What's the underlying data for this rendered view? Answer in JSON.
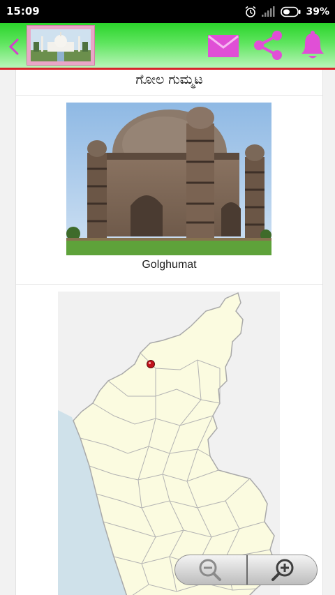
{
  "status_bar": {
    "time": "15:09",
    "battery_percent": "39%",
    "icons": [
      "alarm-icon",
      "signal-icon",
      "battery-icon"
    ]
  },
  "app_bar": {
    "icons": [
      "back-icon",
      "mail-icon",
      "share-icon",
      "bell-icon"
    ],
    "accent_color": "#e04fd6",
    "background_color": "#2bd32b",
    "divider_color": "#d7232a"
  },
  "content": {
    "title": "ಗೋಲ ಗುಮ್ಮಟ",
    "photo_caption": "Golghumat"
  },
  "zoom": {
    "icons": [
      "zoom-out-icon",
      "zoom-in-icon"
    ]
  }
}
